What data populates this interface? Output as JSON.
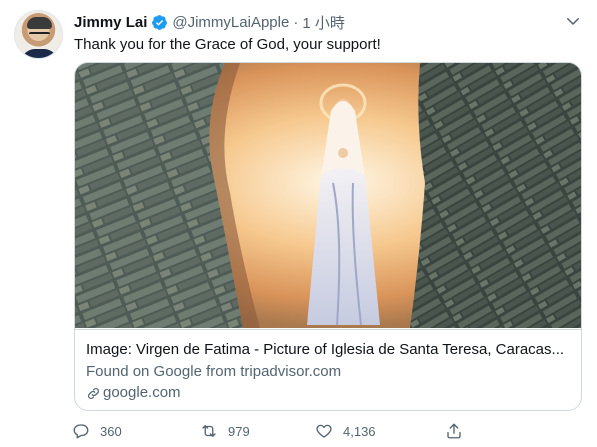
{
  "tweet": {
    "author_name": "Jimmy Lai",
    "handle": "@JimmyLaiApple",
    "separator": "·",
    "time": "1 小時",
    "text": "Thank you for the Grace of God, your support!"
  },
  "card": {
    "image_alt": "Statue of the Virgin in a stone wall niche",
    "title": "Image: Virgen de Fatima - Picture of Iglesia de Santa Teresa, Caracas...",
    "description": "Found on Google from tripadvisor.com",
    "domain": "google.com"
  },
  "actions": {
    "replies": "360",
    "retweets": "979",
    "likes": "4,136"
  },
  "icons": {
    "verified": "verified-badge-icon",
    "more": "chevron-down-icon",
    "link": "link-icon",
    "reply": "reply-icon",
    "retweet": "retweet-icon",
    "like": "heart-icon",
    "share": "share-icon"
  },
  "colors": {
    "verified_blue": "#1d9bf0",
    "secondary_text": "#536471",
    "border": "#cfd9de"
  }
}
